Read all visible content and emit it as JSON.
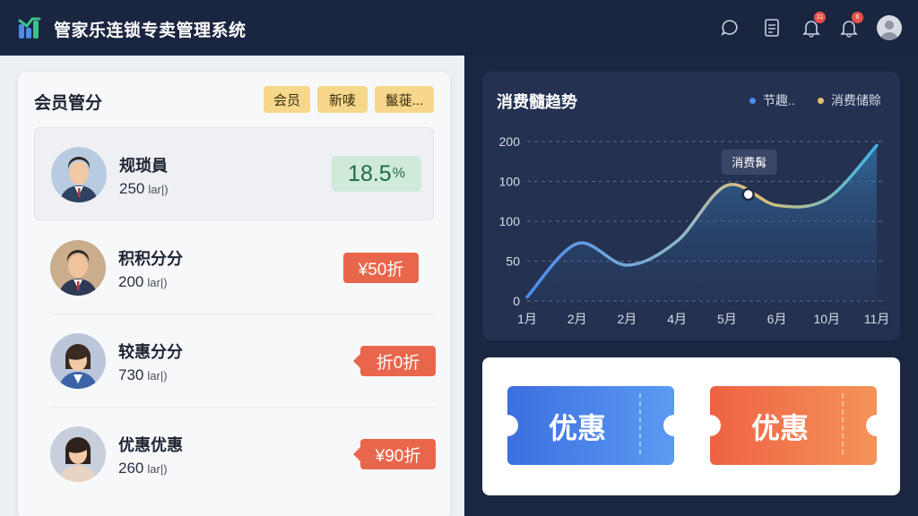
{
  "app": {
    "title": "管家乐连锁专卖管理系统"
  },
  "header": {
    "notification_badge_1": "11",
    "notification_badge_2": "6"
  },
  "member_panel": {
    "title": "会员管分",
    "chips": [
      "会员",
      "新唛",
      "鬣蓰..."
    ],
    "members": [
      {
        "name": "规琐員",
        "points": "250",
        "unit": "lar|)",
        "tag": "18.5",
        "tag_suffix": "%",
        "tag_type": "percent"
      },
      {
        "name": "积积分分",
        "points": "200",
        "unit": "lar|)",
        "tag": "¥50折",
        "tag_type": "discount"
      },
      {
        "name": "较惠分分",
        "points": "730",
        "unit": "lar|)",
        "tag": "折0折",
        "tag_type": "discount"
      },
      {
        "name": "优惠优惠",
        "points": "260",
        "unit": "lar|)",
        "tag": "¥90折",
        "tag_type": "discount"
      }
    ]
  },
  "trend_chart": {
    "title": "消费髓趋势",
    "legend": [
      {
        "label": "节趣..",
        "color": "#4a8cf0"
      },
      {
        "label": "消费储赊",
        "color": "#e6c06e"
      }
    ],
    "tooltip": "消费髯"
  },
  "chart_data": {
    "type": "line",
    "title": "消费髓趋势",
    "x": [
      "1月",
      "2月",
      "2月",
      "4月",
      "5月",
      "6月",
      "10月",
      "11月"
    ],
    "y_ticks": [
      "200",
      "100",
      "100",
      "50",
      "0"
    ],
    "series": [
      {
        "name": "节趣..",
        "values": [
          5,
          72,
          45,
          75,
          145,
          120,
          128,
          195
        ]
      }
    ],
    "ylim": [
      0,
      200
    ],
    "grid": true,
    "legend_position": "top-right"
  },
  "coupons": [
    {
      "label": "优惠",
      "color": "#3f78e6"
    },
    {
      "label": "优惠",
      "color": "#ee6a46"
    }
  ]
}
